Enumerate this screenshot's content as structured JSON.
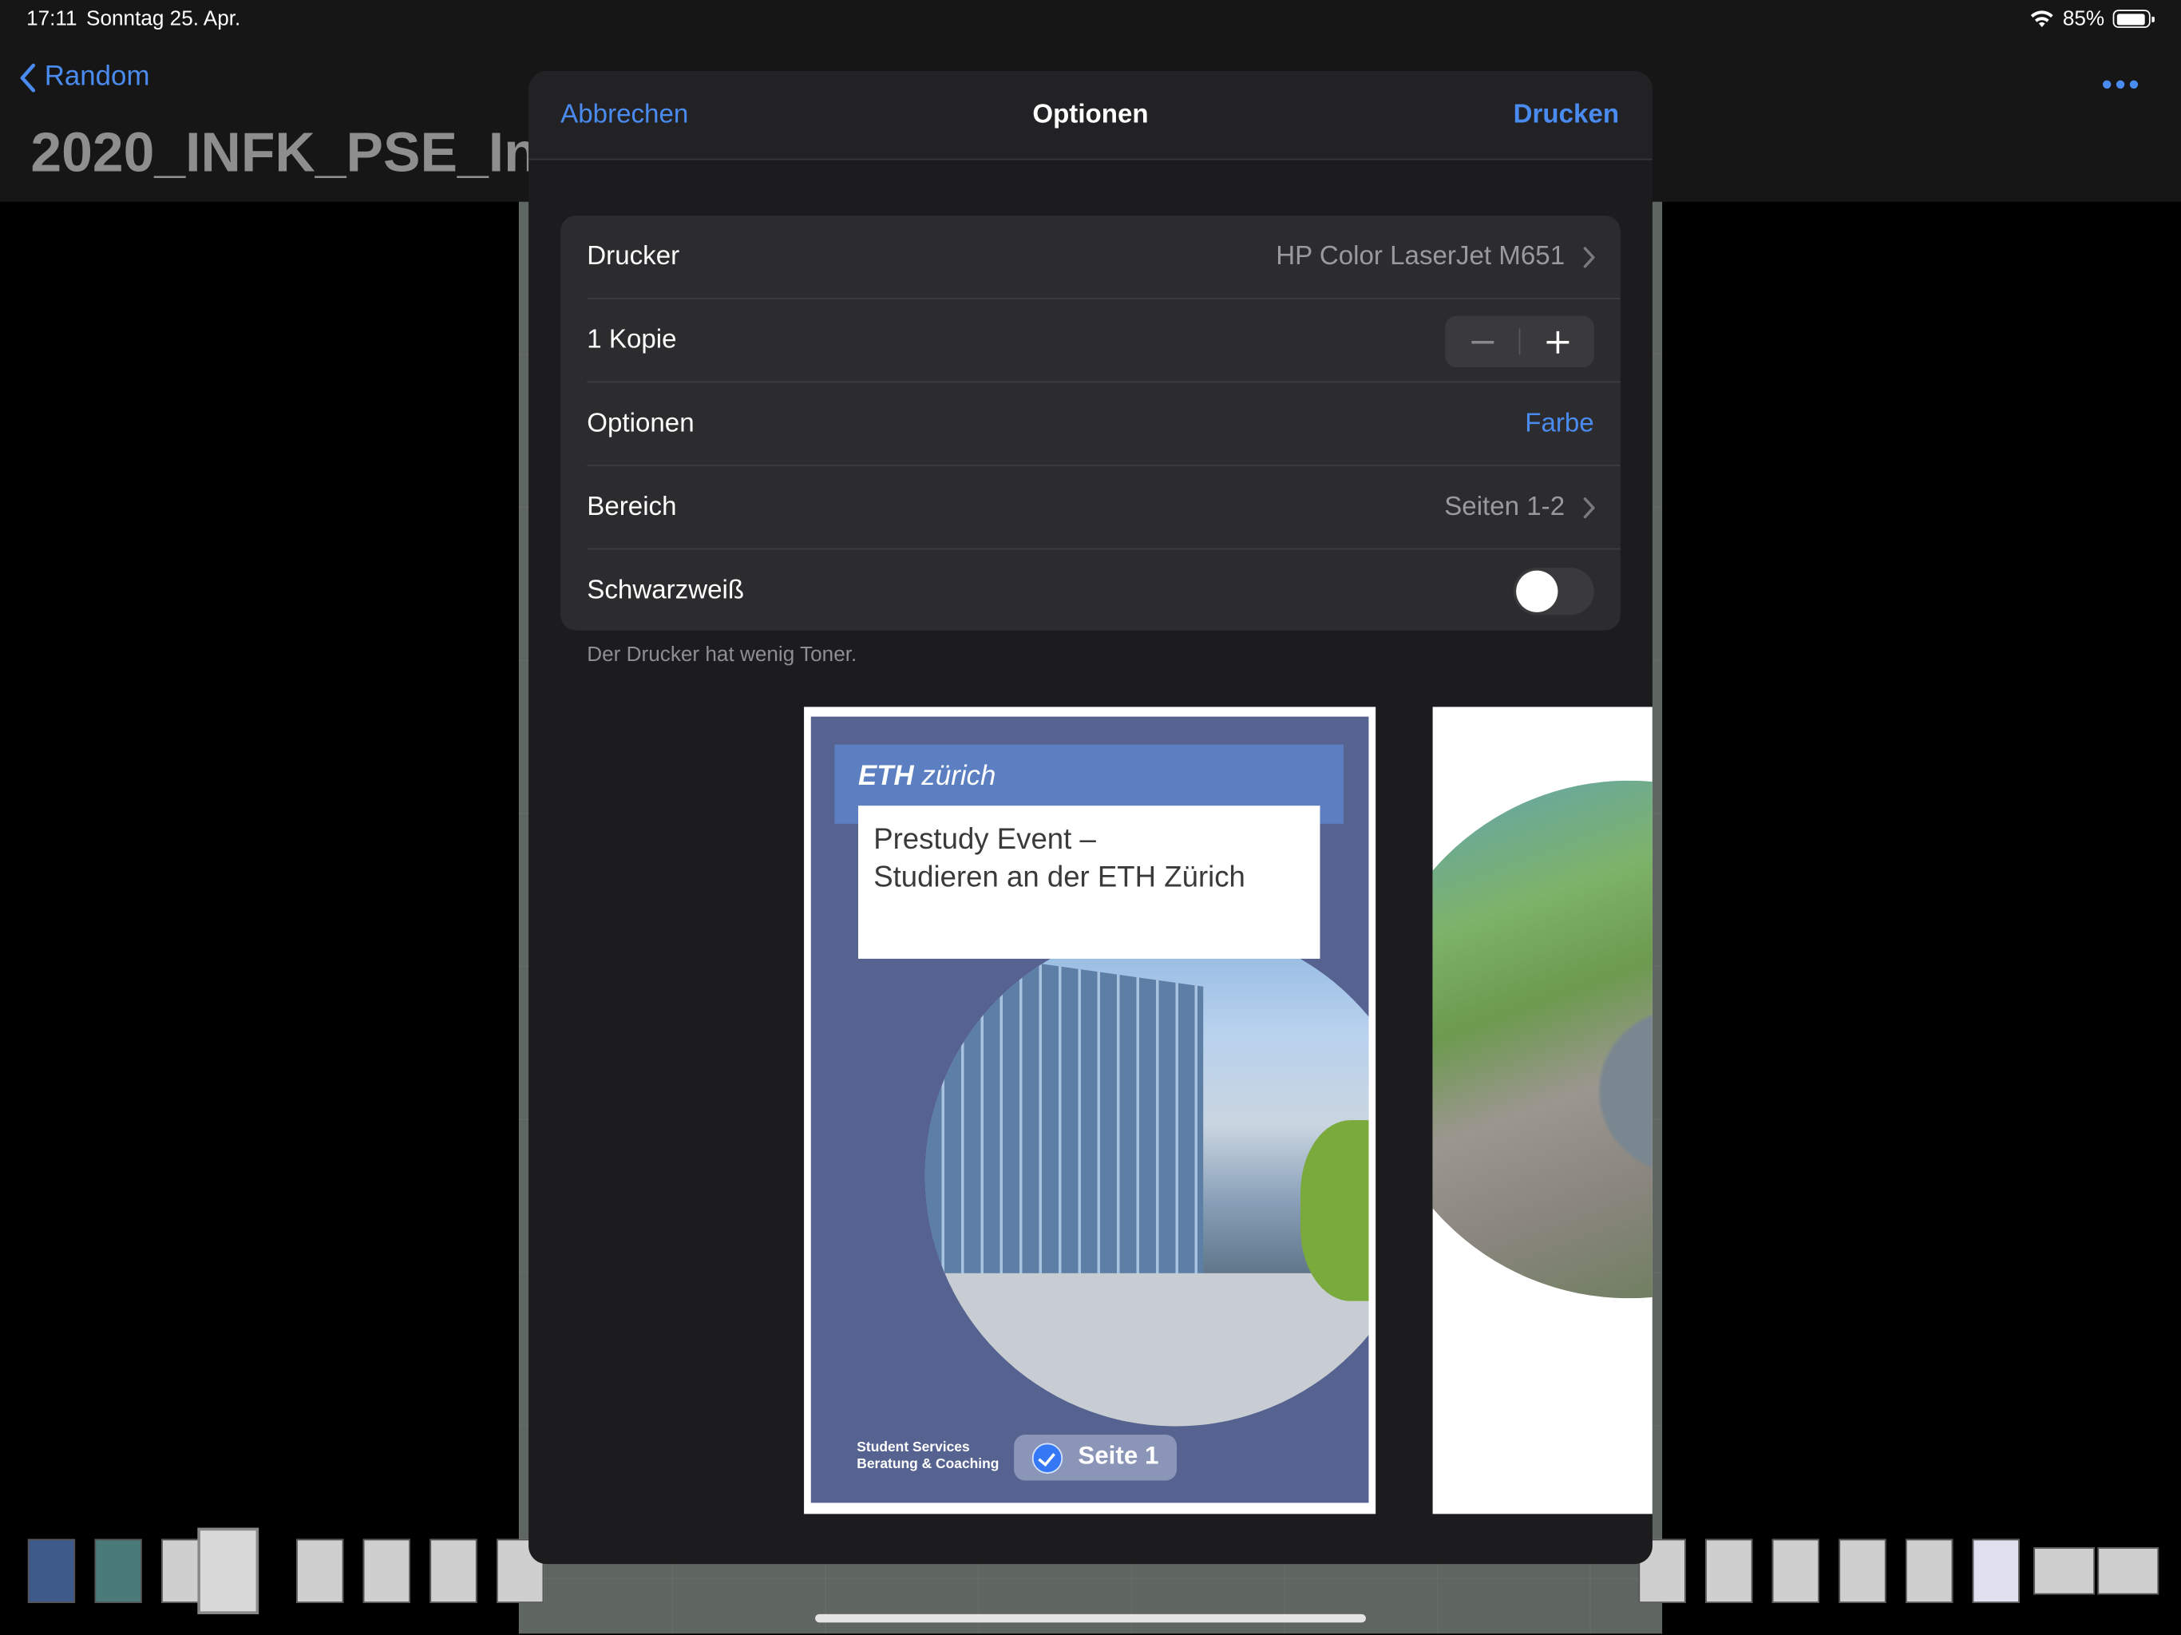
{
  "status_bar": {
    "time": "17:11",
    "date": "Sonntag 25. Apr.",
    "battery": "85%"
  },
  "nav": {
    "back_label": "Random",
    "more_icon": "ellipsis-icon",
    "document_title": "2020_INFK_PSE_In"
  },
  "sheet": {
    "cancel_label": "Abbrechen",
    "title": "Optionen",
    "print_label": "Drucken",
    "rows": [
      {
        "label": "Drucker",
        "value": "HP Color LaserJet M651"
      },
      {
        "label": "1 Kopie",
        "value": ""
      },
      {
        "label": "Optionen",
        "value": "Farbe"
      },
      {
        "label": "Bereich",
        "value": "Seiten 1-2"
      },
      {
        "label": "Schwarzweiß",
        "value": "off"
      }
    ],
    "note": "Der Drucker hat wenig Toner."
  },
  "preview": {
    "page1": {
      "logo_bold": "ETH",
      "logo_rest": "zürich",
      "title_line1": "Prestudy Event –",
      "title_line2": "Studieren an der ETH Zürich",
      "footer_line1": "Student Services",
      "footer_line2": "Beratung & Coaching",
      "badge_label": "Seite 1"
    }
  },
  "colors": {
    "accent": "#4a8bf0",
    "sheet_bg": "#1c1c1e",
    "group_bg": "#2c2c2e"
  }
}
